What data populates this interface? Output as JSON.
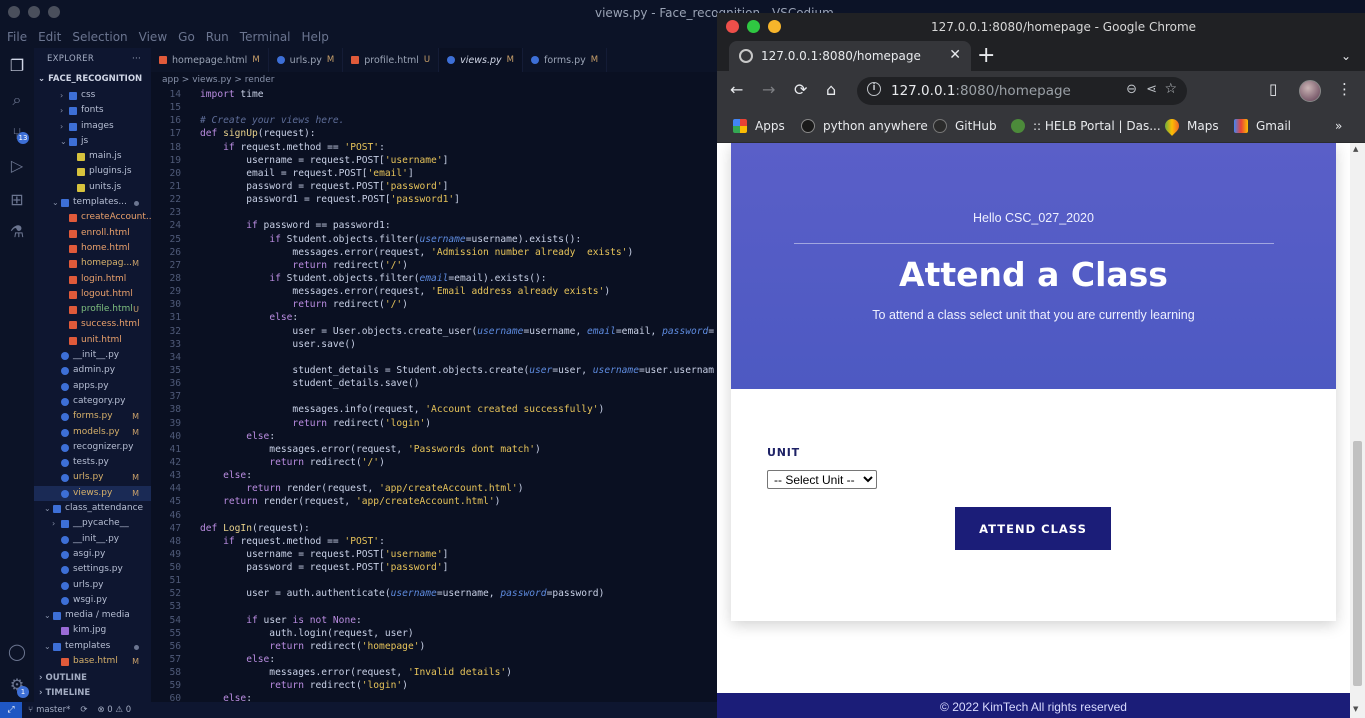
{
  "vscode": {
    "title": "views.py - Face_recognition - VSCodium",
    "menu": [
      "File",
      "Edit",
      "Selection",
      "View",
      "Go",
      "Run",
      "Terminal",
      "Help"
    ],
    "explorer_title": "EXPLORER",
    "explorer_more": "···",
    "project": "FACE_RECOGNITION",
    "tree": [
      {
        "label": "css",
        "kind": "folder",
        "depth": 2,
        "tw": "›"
      },
      {
        "label": "fonts",
        "kind": "folder",
        "depth": 2,
        "tw": "›"
      },
      {
        "label": "images",
        "kind": "folder",
        "depth": 2,
        "tw": "›"
      },
      {
        "label": "js",
        "kind": "folder",
        "depth": 2,
        "tw": "⌄"
      },
      {
        "label": "main.js",
        "kind": "js",
        "depth": 3
      },
      {
        "label": "plugins.js",
        "kind": "js",
        "depth": 3
      },
      {
        "label": "units.js",
        "kind": "js",
        "depth": 3
      },
      {
        "label": "templates...",
        "kind": "folder",
        "depth": 1,
        "tw": "⌄",
        "dot": true
      },
      {
        "label": "createAccount...",
        "kind": "html",
        "depth": 2
      },
      {
        "label": "enroll.html",
        "kind": "html",
        "depth": 2
      },
      {
        "label": "home.html",
        "kind": "html",
        "depth": 2
      },
      {
        "label": "homepag...",
        "kind": "html",
        "depth": 2,
        "mark": "M",
        "mod": true
      },
      {
        "label": "login.html",
        "kind": "html",
        "depth": 2
      },
      {
        "label": "logout.html",
        "kind": "html",
        "depth": 2
      },
      {
        "label": "profile.html",
        "kind": "html",
        "depth": 2,
        "mark": "U",
        "unt": true
      },
      {
        "label": "success.html",
        "kind": "html",
        "depth": 2
      },
      {
        "label": "unit.html",
        "kind": "html",
        "depth": 2
      },
      {
        "label": "__init__.py",
        "kind": "py",
        "depth": 1
      },
      {
        "label": "admin.py",
        "kind": "py",
        "depth": 1
      },
      {
        "label": "apps.py",
        "kind": "py",
        "depth": 1
      },
      {
        "label": "category.py",
        "kind": "py",
        "depth": 1
      },
      {
        "label": "forms.py",
        "kind": "py",
        "depth": 1,
        "mark": "M",
        "mod": true
      },
      {
        "label": "models.py",
        "kind": "py",
        "depth": 1,
        "mark": "M",
        "mod": true
      },
      {
        "label": "recognizer.py",
        "kind": "py",
        "depth": 1
      },
      {
        "label": "tests.py",
        "kind": "py",
        "depth": 1
      },
      {
        "label": "urls.py",
        "kind": "py",
        "depth": 1,
        "mark": "M",
        "mod": true
      },
      {
        "label": "views.py",
        "kind": "py",
        "depth": 1,
        "mark": "M",
        "mod": true,
        "selected": true
      },
      {
        "label": "class_attendance",
        "kind": "folder",
        "depth": 0,
        "tw": "⌄"
      },
      {
        "label": "__pycache__",
        "kind": "folder",
        "depth": 1,
        "tw": "›"
      },
      {
        "label": "__init__.py",
        "kind": "py",
        "depth": 1
      },
      {
        "label": "asgi.py",
        "kind": "py",
        "depth": 1
      },
      {
        "label": "settings.py",
        "kind": "py",
        "depth": 1
      },
      {
        "label": "urls.py",
        "kind": "py",
        "depth": 1
      },
      {
        "label": "wsgi.py",
        "kind": "py",
        "depth": 1
      },
      {
        "label": "media / media",
        "kind": "folder",
        "depth": 0,
        "tw": "⌄"
      },
      {
        "label": "kim.jpg",
        "kind": "img",
        "depth": 1
      },
      {
        "label": "templates",
        "kind": "folder",
        "depth": 0,
        "tw": "⌄",
        "dot": true
      },
      {
        "label": "base.html",
        "kind": "html",
        "depth": 1,
        "mark": "M",
        "mod": true
      }
    ],
    "outline": "OUTLINE",
    "timeline": "TIMELINE",
    "scm_badge": "13",
    "tabs": [
      {
        "label": "homepage.html",
        "mark": "M",
        "kind": "html"
      },
      {
        "label": "urls.py",
        "mark": "M",
        "kind": "py"
      },
      {
        "label": "profile.html",
        "mark": "U",
        "kind": "html"
      },
      {
        "label": "views.py",
        "mark": "M",
        "kind": "py",
        "active": true
      },
      {
        "label": "forms.py",
        "mark": "M",
        "kind": "py"
      }
    ],
    "breadcrumb": "app > views.py > render",
    "code": [
      {
        "n": "14",
        "t": "import time"
      },
      {
        "n": "15",
        "t": ""
      },
      {
        "n": "16",
        "t": "# Create your views here."
      },
      {
        "n": "17",
        "t": "def signUp(request):"
      },
      {
        "n": "18",
        "t": "    if request.method == 'POST':"
      },
      {
        "n": "19",
        "t": "        username = request.POST['username']"
      },
      {
        "n": "20",
        "t": "        email = request.POST['email']"
      },
      {
        "n": "21",
        "t": "        password = request.POST['password']"
      },
      {
        "n": "22",
        "t": "        password1 = request.POST['password1']"
      },
      {
        "n": "23",
        "t": ""
      },
      {
        "n": "24",
        "t": "        if password == password1:"
      },
      {
        "n": "25",
        "t": "            if Student.objects.filter(username=username).exists():"
      },
      {
        "n": "26",
        "t": "                messages.error(request, 'Admission number already  exists')"
      },
      {
        "n": "27",
        "t": "                return redirect('/')"
      },
      {
        "n": "28",
        "t": "            if Student.objects.filter(email=email).exists():"
      },
      {
        "n": "29",
        "t": "                messages.error(request, 'Email address already exists')"
      },
      {
        "n": "30",
        "t": "                return redirect('/')"
      },
      {
        "n": "31",
        "t": "            else:"
      },
      {
        "n": "32",
        "t": "                user = User.objects.create_user(username=username, email=email, password="
      },
      {
        "n": "33",
        "t": "                user.save()"
      },
      {
        "n": "34",
        "t": ""
      },
      {
        "n": "35",
        "t": "                student_details = Student.objects.create(user=user, username=user.usernam"
      },
      {
        "n": "36",
        "t": "                student_details.save()"
      },
      {
        "n": "37",
        "t": ""
      },
      {
        "n": "38",
        "t": "                messages.info(request, 'Account created successfully')"
      },
      {
        "n": "39",
        "t": "                return redirect('login')"
      },
      {
        "n": "40",
        "t": "        else:"
      },
      {
        "n": "41",
        "t": "            messages.error(request, 'Passwords dont match')"
      },
      {
        "n": "42",
        "t": "            return redirect('/')"
      },
      {
        "n": "43",
        "t": "    else:"
      },
      {
        "n": "44",
        "t": "        return render(request, 'app/createAccount.html')"
      },
      {
        "n": "45",
        "t": "    return render(request, 'app/createAccount.html')"
      },
      {
        "n": "46",
        "t": ""
      },
      {
        "n": "47",
        "t": "def LogIn(request):"
      },
      {
        "n": "48",
        "t": "    if request.method == 'POST':"
      },
      {
        "n": "49",
        "t": "        username = request.POST['username']"
      },
      {
        "n": "50",
        "t": "        password = request.POST['password']"
      },
      {
        "n": "51",
        "t": ""
      },
      {
        "n": "52",
        "t": "        user = auth.authenticate(username=username, password=password)"
      },
      {
        "n": "53",
        "t": ""
      },
      {
        "n": "54",
        "t": "        if user is not None:"
      },
      {
        "n": "55",
        "t": "            auth.login(request, user)"
      },
      {
        "n": "56",
        "t": "            return redirect('homepage')"
      },
      {
        "n": "57",
        "t": "        else:"
      },
      {
        "n": "58",
        "t": "            messages.error(request, 'Invalid details')"
      },
      {
        "n": "59",
        "t": "            return redirect('login')"
      },
      {
        "n": "60",
        "t": "    else:"
      }
    ],
    "status": {
      "branch": "master*",
      "errors": "⊗ 0 ⚠ 0",
      "notif_badge": "1"
    }
  },
  "chrome": {
    "window_title": "127.0.0.1:8080/homepage - Google Chrome",
    "tab_title": "127.0.0.1:8080/homepage",
    "url_host": "127.0.0.1",
    "url_path": ":8080/homepage",
    "bookmarks": [
      {
        "label": "Apps",
        "color": "#e94235"
      },
      {
        "label": "python anywhere",
        "color": "#1a1a1a"
      },
      {
        "label": "GitHub",
        "color": "#2b2b2b"
      },
      {
        "label": ":: HELB Portal | Das...",
        "color": "#4c8a3a"
      },
      {
        "label": "Maps",
        "color": "#34a853"
      },
      {
        "label": "Gmail",
        "color": "#ea4335"
      }
    ],
    "more_bookmarks": "»"
  },
  "page": {
    "greeting": "Hello CSC_027_2020",
    "title": "Attend a Class",
    "subtitle": "To attend a class select unit that you are currently learning",
    "unit_label": "UNIT",
    "unit_selected": "-- Select Unit --",
    "submit_label": "ATTEND CLASS",
    "footer": "© 2022 KimTech All rights reserved",
    "colors": {
      "hero": "#5a5fc8",
      "button": "#1b1d78",
      "footer": "#1b1d78"
    }
  }
}
